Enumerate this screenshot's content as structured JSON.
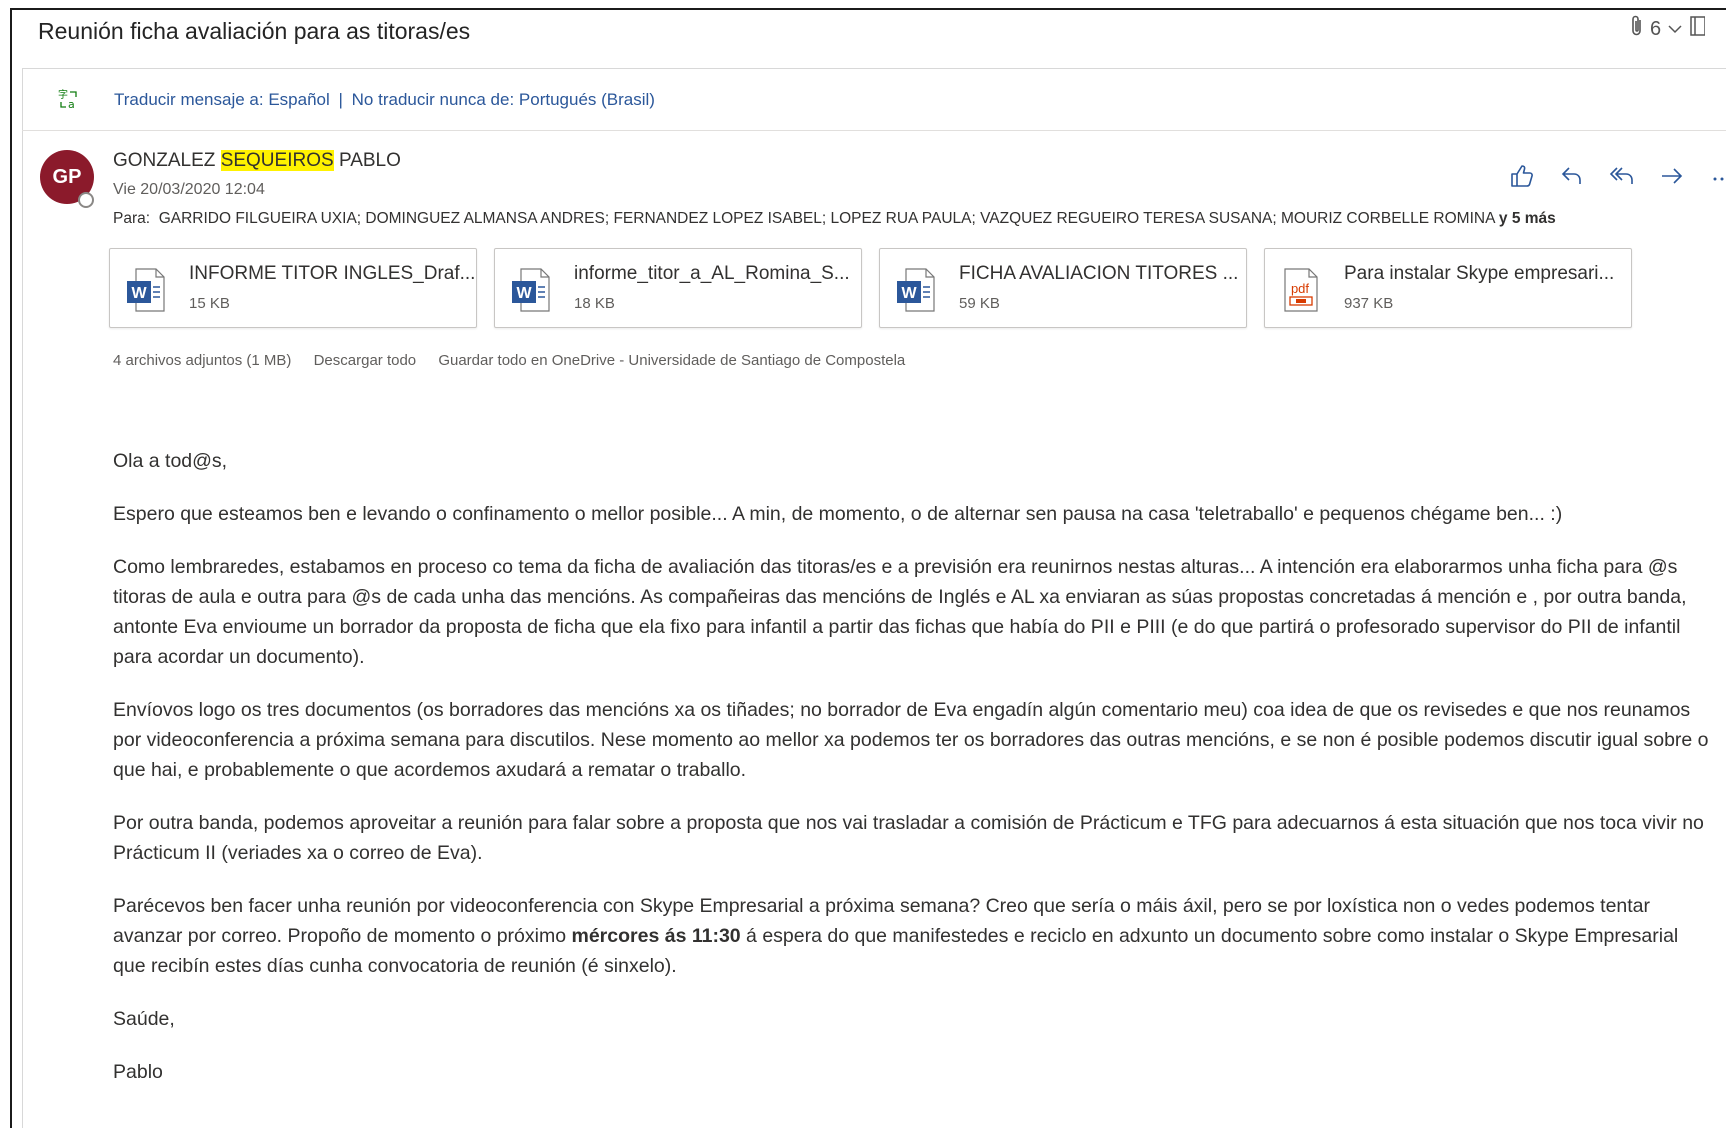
{
  "subject": "Reunión ficha avaliación para as titoras/es",
  "thread_count": "6",
  "translate": {
    "translate_link": "Traducir mensaje a: Español",
    "separator": "|",
    "never_link": "No traducir nunca de: Portugués (Brasil)"
  },
  "sender": {
    "initials": "GP",
    "name_part1": "GONZALEZ",
    "name_highlight": "SEQUEIROS",
    "name_part2": "PABLO",
    "date": "Vie 20/03/2020 12:04",
    "to_label": "Para:",
    "to_list": "GARRIDO FILGUEIRA UXIA; DOMINGUEZ ALMANSA ANDRES; FERNANDEZ LOPEZ ISABEL; LOPEZ RUA PAULA; VAZQUEZ REGUEIRO TERESA SUSANA; MOURIZ CORBELLE ROMINA",
    "to_more": "y 5 más"
  },
  "attachments": [
    {
      "name": "INFORME TITOR INGLES_Draf...",
      "size": "15 KB",
      "type": "word"
    },
    {
      "name": "informe_titor_a_AL_Romina_S...",
      "size": "18 KB",
      "type": "word"
    },
    {
      "name": "FICHA AVALIACION TITORES ...",
      "size": "59 KB",
      "type": "word"
    },
    {
      "name": "Para instalar Skype empresari...",
      "size": "937 KB",
      "type": "pdf"
    }
  ],
  "attachments_meta": {
    "count": "4 archivos adjuntos (1 MB)",
    "download_all": "Descargar todo",
    "save_onedrive": "Guardar todo en OneDrive - Universidade de Santiago de Compostela"
  },
  "body": {
    "greeting": "Ola a tod@s,",
    "p1": "Espero que esteamos ben e levando o confinamento o mellor posible... A min, de momento, o de alternar sen pausa na casa 'teletraballo' e pequenos chégame ben... :)",
    "p2": "Como lembraredes, estabamos en proceso co tema da ficha de avaliación das titoras/es e a previsión era reunirnos nestas alturas... A intención era elaborarmos unha ficha para @s titoras de aula e outra para @s de cada unha das mencións. As compañeiras das mencións de Inglés e AL xa enviaran as súas propostas concretadas á mención e , por outra banda, antonte Eva envioume un borrador da proposta de ficha que ela fixo para infantil a partir das fichas que había do PII e PIII (e do que partirá o profesorado supervisor do PII de infantil para acordar un documento).",
    "p3": "Envíovos logo os tres documentos (os borradores das mencións xa os tiñades; no borrador de Eva engadín algún comentario meu) coa idea de que os revisedes e que nos reunamos por videoconferencia a próxima semana para discutilos. Nese momento ao mellor xa podemos ter os borradores das outras mencións, e se non é posible podemos discutir igual sobre o que hai, e probablemente o que acordemos axudará a rematar o traballo.",
    "p4": "Por outra banda, podemos aproveitar a reunión para falar sobre a proposta que nos vai trasladar a comisión de Prácticum e TFG para adecuarnos á esta situación que nos toca vivir no Prácticum II  (veriades xa o correo de Eva).",
    "p5_a": "Parécevos ben facer unha reunión por videoconferencia con Skype Empresarial a próxima semana? Creo que sería o máis áxil, pero se por loxística non o vedes podemos tentar avanzar por correo. Propoño de momento o próximo ",
    "p5_bold": "mércores ás 11:30",
    "p5_b": " á espera do que manifestedes e reciclo en adxunto un documento sobre como instalar o Skype Empresarial que recibín estes días cunha convocatoria de reunión (é sinxelo).",
    "closing": "Saúde,",
    "signature": "Pablo"
  },
  "colors": {
    "avatar": "#8b1a2b",
    "link": "#2b579a",
    "highlight": "#fff200",
    "action_icon": "#2b579a",
    "word": "#2b579a",
    "pdf": "#d83b01"
  }
}
